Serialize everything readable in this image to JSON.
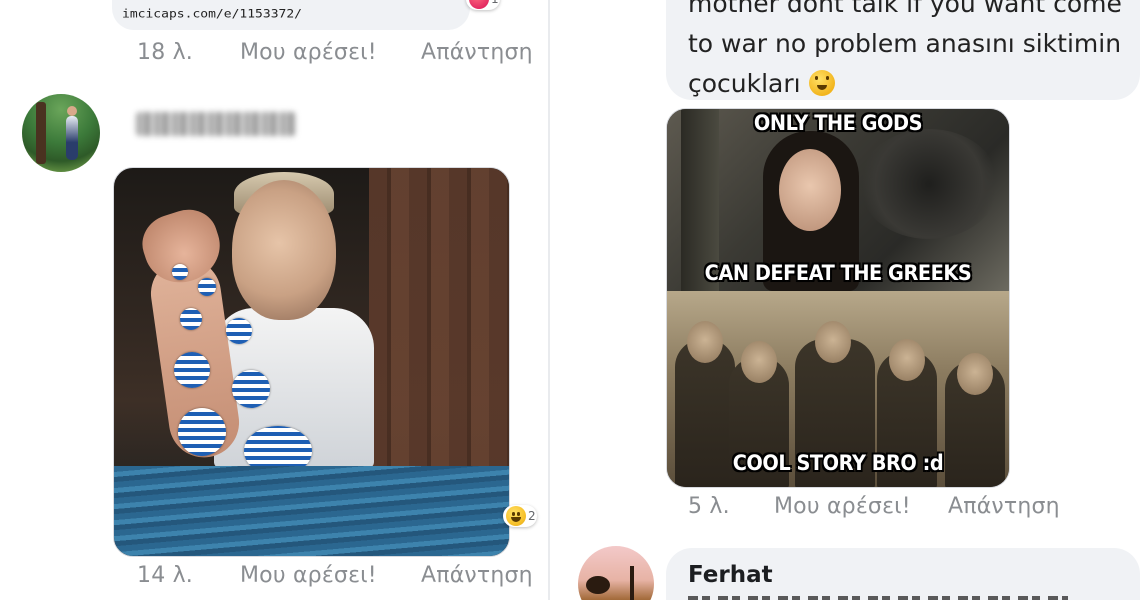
{
  "left": {
    "link_preview": {
      "url": "imcicaps.com/e/1153372/",
      "reaction_count": "1"
    },
    "comment_1": {
      "time": "18 λ.",
      "like": "Μου αρέσει!",
      "reply": "Απάντηση"
    },
    "comment_2": {
      "reaction_count": "2",
      "time": "14 λ.",
      "like": "Μου αρέσει!",
      "reply": "Απάντηση"
    }
  },
  "right": {
    "comment_1": {
      "text_lines": [
        "mother dont talk if you want come",
        "to war no problem anasını siktimin",
        "çocukları"
      ],
      "meme_top_caption": "ONLY THE GODS",
      "meme_middle_caption": "CAN DEFEAT THE GREEKS",
      "meme_bottom_caption": "COOL STORY BRO :d",
      "time": "5 λ.",
      "like": "Μου αρέσει!",
      "reply": "Απάντηση"
    },
    "comment_2": {
      "author": "Ferhat"
    }
  },
  "colors": {
    "bubble": "#f0f2f5",
    "meta_text": "#8a8d91",
    "flag_blue": "#1e5fb4"
  }
}
